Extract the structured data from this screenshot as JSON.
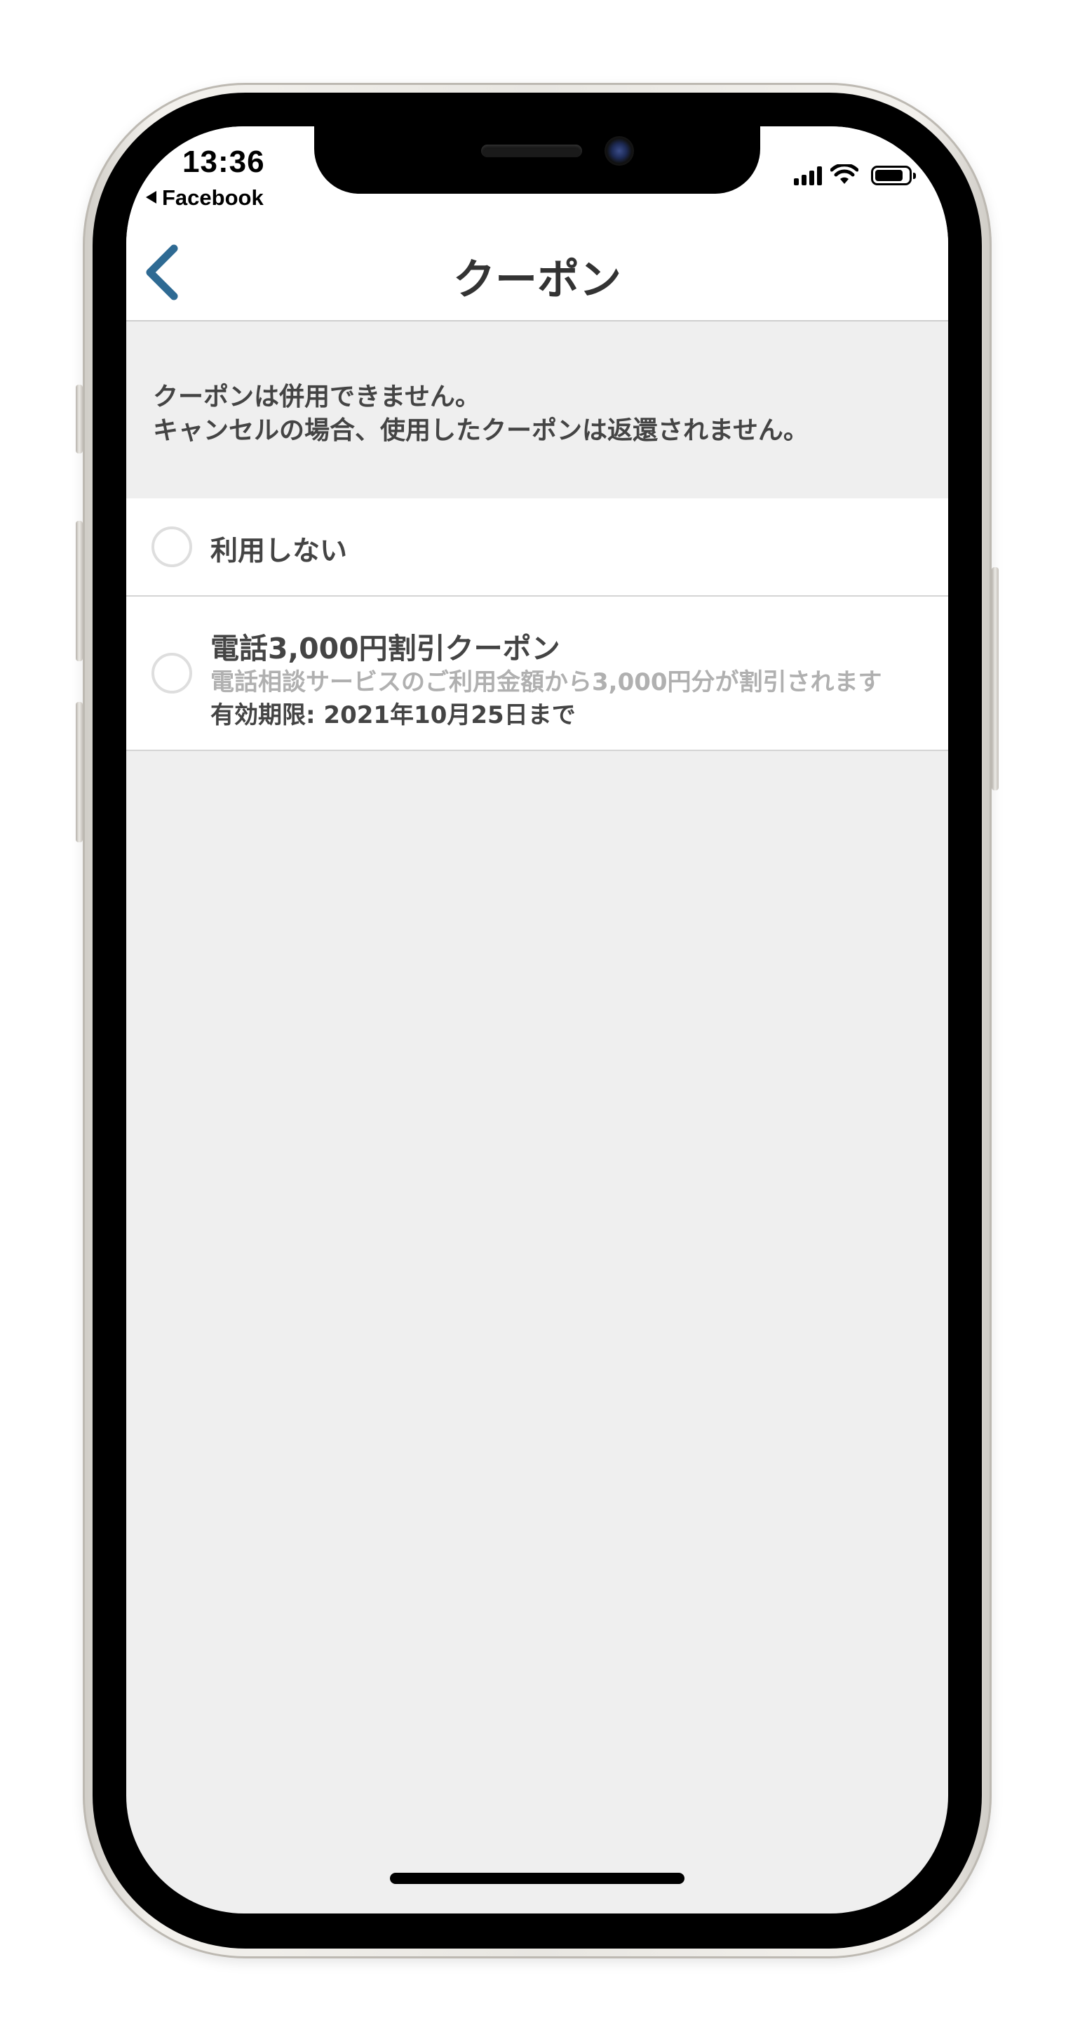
{
  "status_bar": {
    "time": "13:36",
    "back_app": "Facebook",
    "icons": [
      "cellular-signal-icon",
      "wifi-icon",
      "battery-icon"
    ]
  },
  "nav": {
    "title": "クーポン",
    "back_icon": "chevron-left-icon",
    "back_color": "#2e6a93"
  },
  "notice": {
    "line1": "クーポンは併用できません。",
    "line2": "キャンセルの場合、使用したクーポンは返還されません。"
  },
  "options": {
    "none": {
      "label": "利用しない",
      "selected": false
    },
    "coupon": {
      "title": "電話3,000円割引クーポン",
      "description": "電話相談サービスのご利用金額から3,000円分が割引されます",
      "expiry": "有効期限: 2021年10月25日まで",
      "selected": false
    }
  },
  "colors": {
    "background": "#efefef",
    "text": "#444444",
    "muted": "#b0b0b0",
    "divider": "#d4d4d4"
  }
}
